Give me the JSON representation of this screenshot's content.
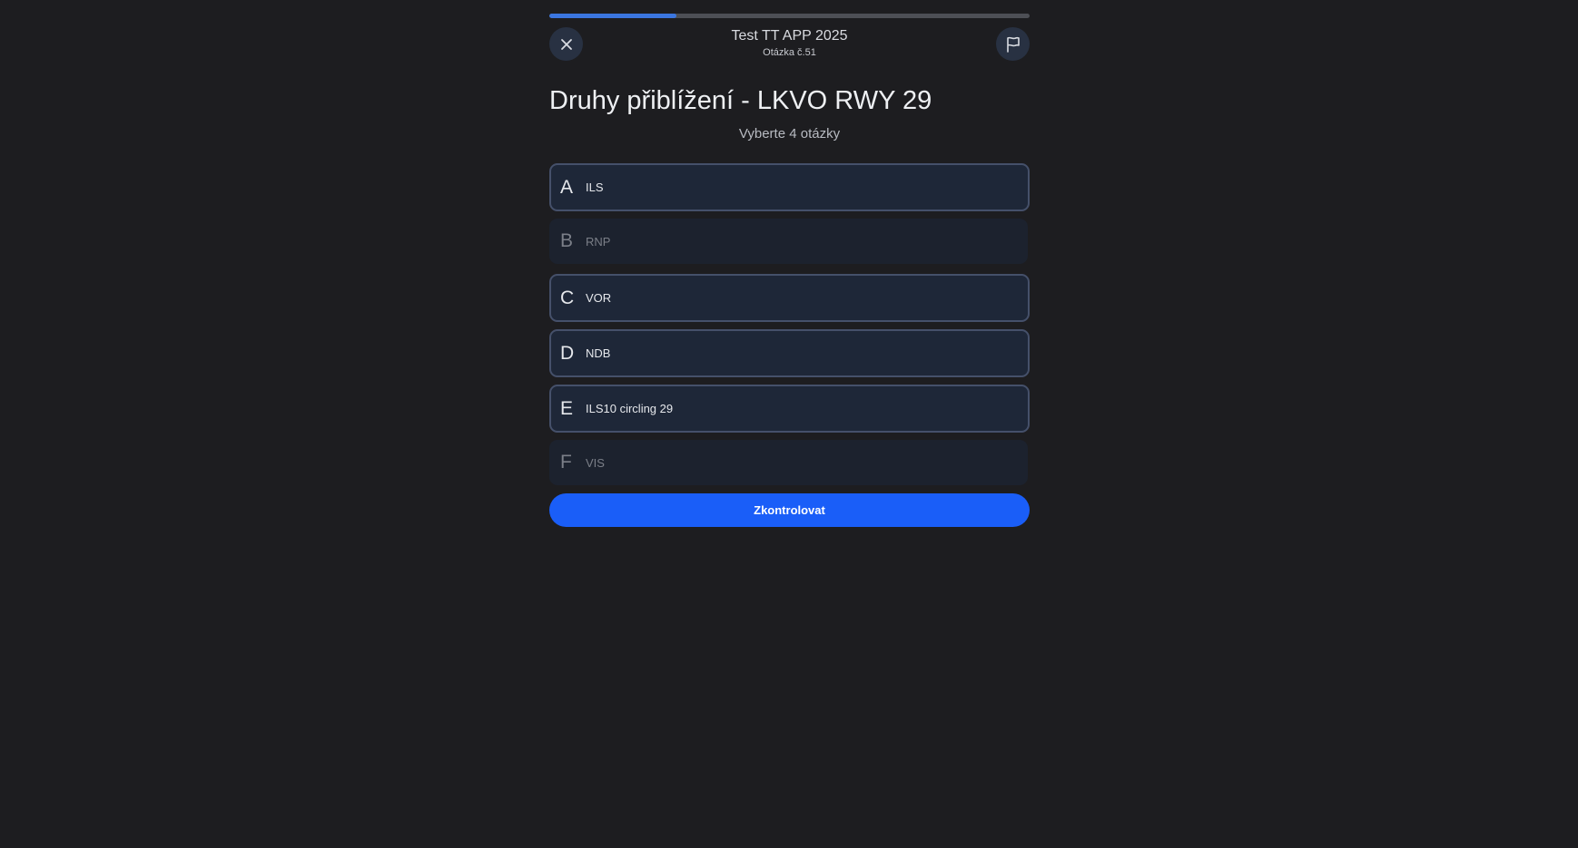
{
  "header": {
    "test_title": "Test TT APP 2025",
    "question_number": "Otázka č.51",
    "close_icon": "close-icon",
    "flag_icon": "flag-icon"
  },
  "progress": {
    "fraction": 0.265,
    "color": "#3b76e0",
    "track_color": "#4d4f55"
  },
  "question": {
    "title": "Druhy přiblížení - LKVO RWY 29",
    "instruction": "Vyberte 4 otázky"
  },
  "options": [
    {
      "letter": "A",
      "text": "ILS",
      "enabled": true
    },
    {
      "letter": "B",
      "text": "RNP",
      "enabled": false
    },
    {
      "letter": "C",
      "text": "VOR",
      "enabled": true
    },
    {
      "letter": "D",
      "text": "NDB",
      "enabled": true
    },
    {
      "letter": "E",
      "text": "ILS10 circling 29",
      "enabled": true
    },
    {
      "letter": "F",
      "text": "VIS",
      "enabled": false
    }
  ],
  "submit": {
    "label": "Zkontrolovat",
    "color": "#1a5ef8"
  }
}
